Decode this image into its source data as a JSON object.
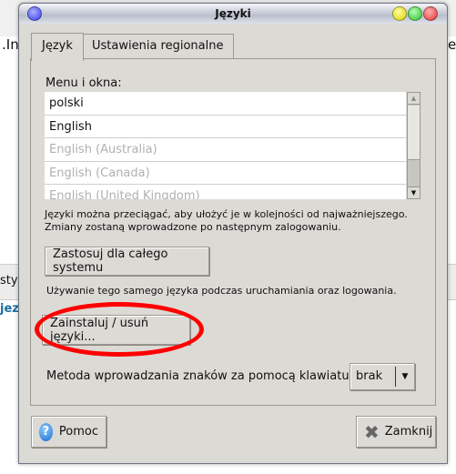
{
  "background": {
    "text_top": ".In",
    "text_top_right": "e",
    "text_mid": "sty",
    "text_link": "jez"
  },
  "window": {
    "title": "Języki"
  },
  "tabs": [
    {
      "label": "Język",
      "active": true
    },
    {
      "label": "Ustawienia regionalne",
      "active": false
    }
  ],
  "languages": {
    "label": "Menu i okna:",
    "items": [
      {
        "label": "polski",
        "enabled": true
      },
      {
        "label": "English",
        "enabled": true
      },
      {
        "label": "English (Australia)",
        "enabled": false
      },
      {
        "label": "English (Canada)",
        "enabled": false
      },
      {
        "label": "English (United Kingdom)",
        "enabled": false
      }
    ]
  },
  "hint_line1": "Języki można przeciągać, aby ułożyć je w kolejności od najważniejszego.",
  "hint_line2": "Zmiany zostaną wprowadzone po następnym zalogowaniu.",
  "apply_button": "Zastosuj dla całego systemu",
  "apply_hint": "Używanie tego samego języka podczas uruchamiania oraz logowania.",
  "install_button": "Zainstaluj / usuń języki...",
  "annotation_color": "#ff0000",
  "input_method": {
    "label": "Metoda wprowadzania znaków za pomocą klawiatury:",
    "value": "brak"
  },
  "help_button": "Pomoc",
  "close_button": "Zamknij"
}
